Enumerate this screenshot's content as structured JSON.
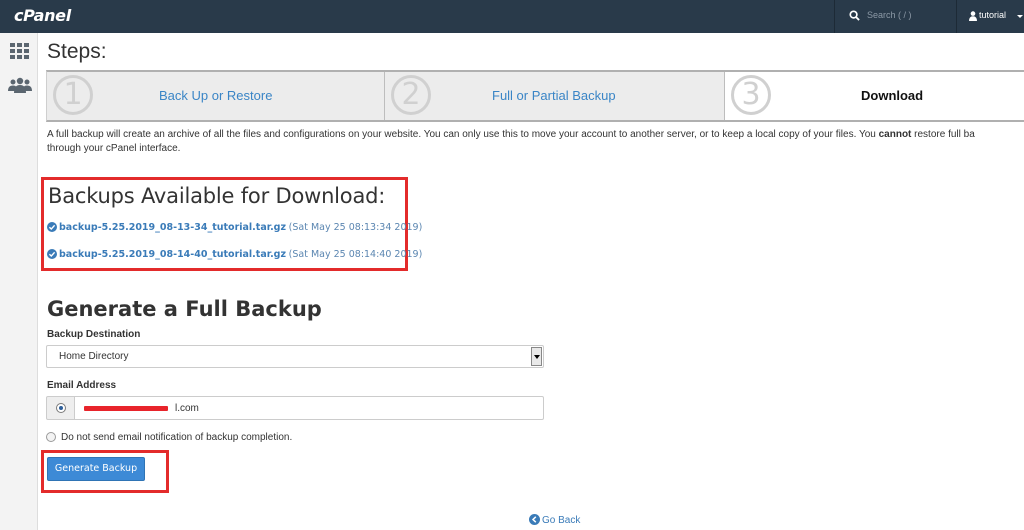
{
  "app": {
    "logo": "cPanel"
  },
  "topbar": {
    "search_placeholder": "Search ( / )",
    "username": "tutorial"
  },
  "page": {
    "steps_title": "Steps:",
    "wizard": [
      {
        "number": "1",
        "label": "Back Up or Restore",
        "active": false
      },
      {
        "number": "2",
        "label": "Full or Partial Backup",
        "active": false
      },
      {
        "number": "3",
        "label": "Download",
        "active": true
      }
    ],
    "description_part1": "A full backup will create an archive of all the files and configurations on your website. You can only use this to move your account to another server, or to keep a local copy of your files. You ",
    "description_bold": "cannot",
    "description_part2": " restore full ba",
    "description_line2": "through your cPanel interface."
  },
  "backups": {
    "heading": "Backups Available for Download:",
    "items": [
      {
        "file": "backup-5.25.2019_08-13-34_tutorial.tar.gz",
        "date": "(Sat May 25 08:13:34 2019)"
      },
      {
        "file": "backup-5.25.2019_08-14-40_tutorial.tar.gz",
        "date": "(Sat May 25 08:14:40 2019)"
      }
    ]
  },
  "generate": {
    "heading": "Generate a Full Backup",
    "destination_label": "Backup Destination",
    "destination_value": "Home Directory",
    "email_label": "Email Address",
    "email_value_visible": "l.com",
    "no_email_label": "Do not send email notification of backup completion.",
    "button_label": "Generate Backup"
  },
  "footer": {
    "go_back": "Go Back"
  },
  "colors": {
    "topbar_bg": "#293a4a",
    "link": "#3a7bb8",
    "button": "#3d8ad6",
    "highlight": "#e32b2b"
  }
}
